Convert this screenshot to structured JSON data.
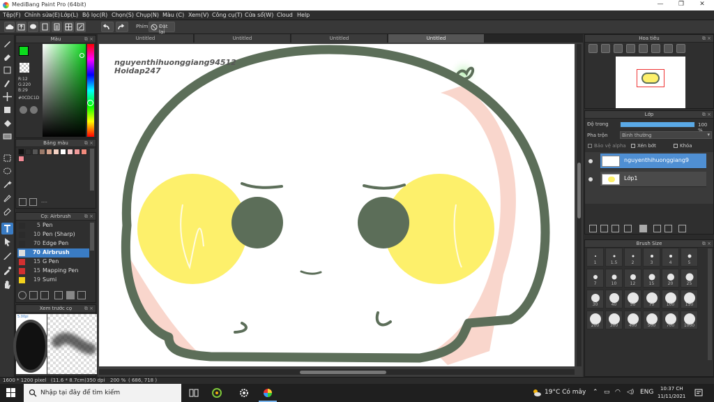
{
  "window": {
    "title": "MediBang Paint Pro (64bit)",
    "minimize": "—",
    "maximize": "❐",
    "close": "✕"
  },
  "menu": [
    "Tệp(F)",
    "Chỉnh sửa(E)",
    "Lớp(L)",
    "Bộ lọc(R)",
    "Chọn(S)",
    "Chụp(N)",
    "Màu (C)",
    "Xem(V)",
    "Công cụ(T)",
    "Cửa sổ(W)",
    "Cloud",
    "Help"
  ],
  "toolbar": {
    "brush_label": "Phím",
    "reset_label": "Đặt lại"
  },
  "color_panel": {
    "title": "Màu",
    "r": "R:12",
    "g": "G:220",
    "b": "B:29",
    "hex": "#0CDC1D",
    "fg_color": "#0CDC1D"
  },
  "palette_panel": {
    "title": "Bảng màu",
    "swatches": [
      "#111111",
      "#333333",
      "#555555",
      "#9a7a6a",
      "#d6a58f",
      "#f4d2c4",
      "#ffffff",
      "#f3c8c8",
      "#f09a9a",
      "#f28b7c"
    ],
    "footer": "----"
  },
  "brush_panel": {
    "title": "Cọ: Airbrush",
    "brushes": [
      {
        "size": "5",
        "name": "Pen",
        "color": "#2b2b2b"
      },
      {
        "size": "10",
        "name": "Pen (Sharp)",
        "color": "#2b2b2b"
      },
      {
        "size": "70",
        "name": "Edge Pen",
        "color": "#2b2b2b"
      },
      {
        "size": "70",
        "name": "Airbrush",
        "color": "#dddddd"
      },
      {
        "size": "15",
        "name": "G Pen",
        "color": "#d23030"
      },
      {
        "size": "15",
        "name": "Mapping Pen",
        "color": "#d23030"
      },
      {
        "size": "19",
        "name": "Sumi",
        "color": "#f2d11c"
      }
    ]
  },
  "preview_panel": {
    "title": "Xem trước cọ",
    "label": "5.00pi"
  },
  "doc_tabs": [
    "Untitled",
    "Untitled",
    "Untitled",
    "Untitled"
  ],
  "canvas": {
    "watermark_line1": "nguyenthihuonggiang94512",
    "watermark_line2": "Hoidap247"
  },
  "nav_panel": {
    "title": "Hoa tiêu"
  },
  "layer_panel": {
    "title": "Lớp",
    "opacity_label": "Độ trong",
    "opacity_value": "100 %",
    "blend_label": "Pha trộn",
    "blend_value": "Bình thường",
    "protect_alpha": "Bảo vệ alpha",
    "clip": "Xén bớt",
    "lock": "Khóa",
    "layers": [
      {
        "name": "nguyenthihuonggiang9",
        "active": true
      },
      {
        "name": "Lớp1",
        "active": false
      }
    ]
  },
  "size_panel": {
    "title": "Brush Size",
    "sizes": [
      "1",
      "1.5",
      "2",
      "3",
      "4",
      "5",
      "7",
      "10",
      "12",
      "15",
      "20",
      "25",
      "30",
      "40",
      "50",
      "70",
      "100",
      "150",
      "200",
      "300",
      "400",
      "500",
      "700",
      "1000"
    ]
  },
  "status": {
    "pixels": "1600 * 1200 pixel",
    "cm": "(11.6 * 8.7cm)",
    "dpi": "350 dpi",
    "zoom": "200 %",
    "coords": "( 686, 718 )"
  },
  "taskbar": {
    "search_placeholder": "Nhập tại đây để tìm kiếm",
    "weather": "19°C  Có mây",
    "lang": "ENG",
    "time": "10:37 CH",
    "date": "11/11/2021"
  }
}
